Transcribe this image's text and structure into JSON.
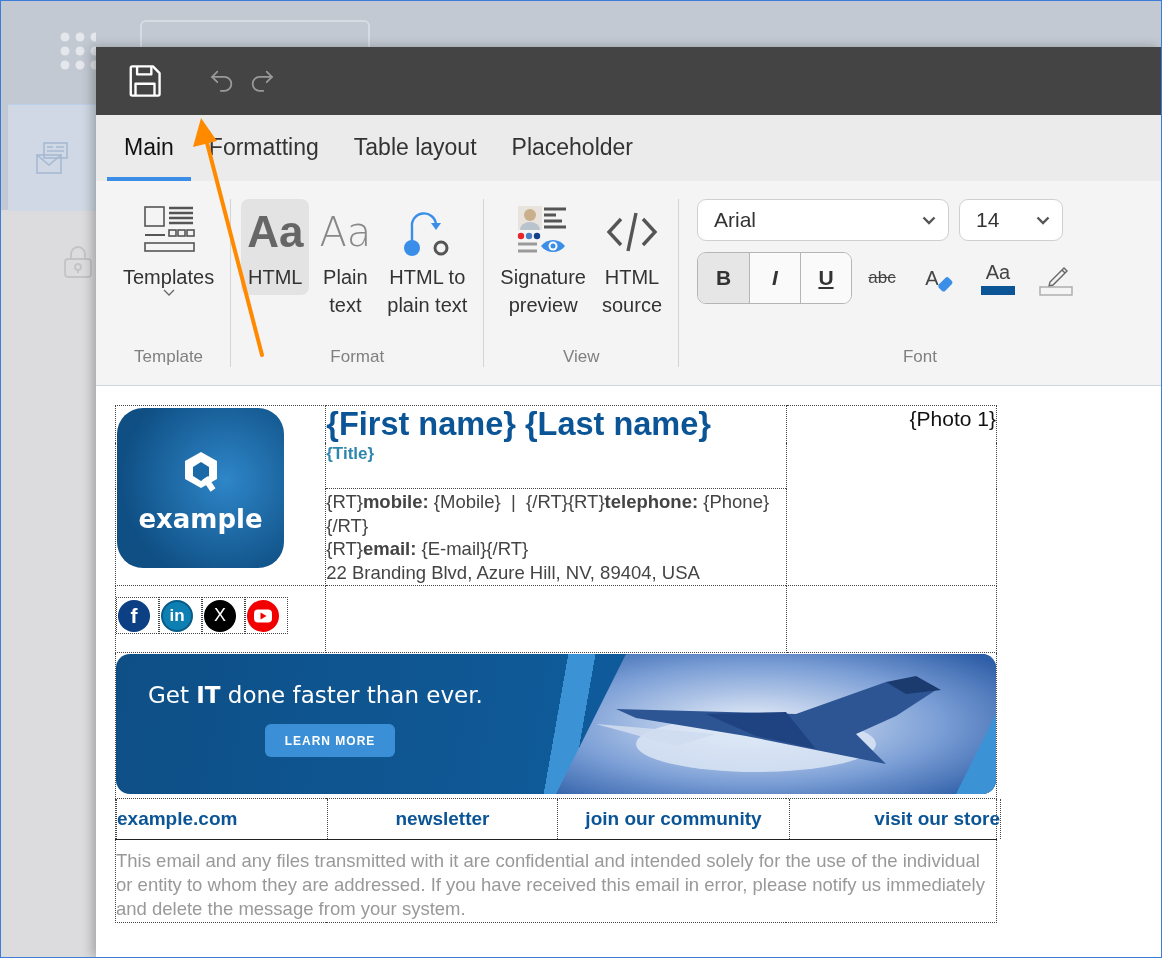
{
  "tabs": [
    {
      "label": "Main",
      "selected": true
    },
    {
      "label": "Formatting",
      "selected": false
    },
    {
      "label": "Table layout",
      "selected": false
    },
    {
      "label": "Placeholder",
      "selected": false
    }
  ],
  "ribbon": {
    "groups": [
      {
        "label": "Template",
        "buttons": [
          {
            "kind": "templates",
            "label": "Templates",
            "selected": false
          }
        ]
      },
      {
        "label": "Format",
        "buttons": [
          {
            "kind": "html",
            "glyph": "Aa",
            "label": "HTML",
            "selected": true
          },
          {
            "kind": "plain",
            "glyph": "Aa",
            "label": "Plain\ntext",
            "selected": false
          },
          {
            "kind": "convert",
            "label": "HTML to\nplain text",
            "selected": false
          }
        ]
      },
      {
        "label": "View",
        "buttons": [
          {
            "kind": "preview",
            "label": "Signature\npreview",
            "selected": false
          },
          {
            "kind": "source",
            "label": "HTML\nsource",
            "selected": false
          }
        ]
      }
    ],
    "font": {
      "label": "Font",
      "font_name": "Arial",
      "font_size": "14",
      "styles": [
        {
          "kind": "bold",
          "label": "B",
          "selected": true
        },
        {
          "kind": "italic",
          "label": "I",
          "selected": false
        },
        {
          "kind": "underline",
          "label": "U",
          "selected": false
        }
      ],
      "tools": [
        {
          "kind": "strike",
          "label": "abc"
        },
        {
          "kind": "clear",
          "label": "A"
        },
        {
          "kind": "color",
          "label": "Aa",
          "color": "#0b5597"
        },
        {
          "kind": "highlight"
        }
      ]
    }
  },
  "signature": {
    "logo_text": "example",
    "name": "{First name} {Last name}",
    "title": "{Title}",
    "photo": "{Photo 1}",
    "contact_lines": [
      "{RT}**mobile:** {Mobile}  |  {/RT}{RT}**telephone:** {Phone} {/RT}",
      "{RT}**email:** {E-mail}{/RT}",
      "22 Branding Blvd, Azure Hill, NV, 89404, USA"
    ],
    "social": [
      {
        "kind": "facebook",
        "glyph": "f"
      },
      {
        "kind": "linkedin",
        "glyph": "in"
      },
      {
        "kind": "x",
        "glyph": "X"
      },
      {
        "kind": "youtube"
      }
    ],
    "banner": {
      "headline": "Get **IT** done faster than ever.",
      "button": "LEARN MORE"
    },
    "links": [
      {
        "label": "example.com"
      },
      {
        "label": "newsletter"
      },
      {
        "label": "join our community"
      },
      {
        "label": "visit our store"
      }
    ],
    "disclaimer": "This email and any files transmitted with it are confidential and intended solely for the use of the individual or entity to whom they are addressed. If you have received this email in error, please notify us immediately and delete the message from your system."
  }
}
